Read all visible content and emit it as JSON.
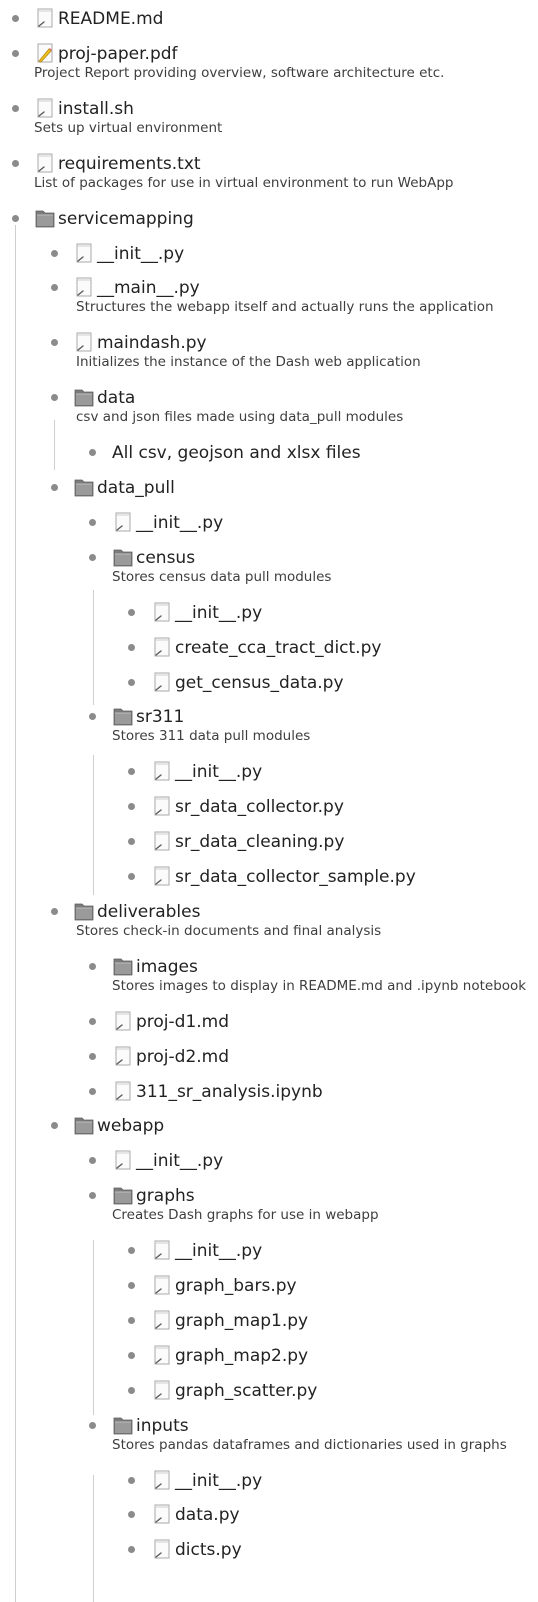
{
  "tree": [
    {
      "name": "README.md",
      "type": "file"
    },
    {
      "name": "proj-paper.pdf",
      "type": "pdf",
      "desc": "Project Report providing overview, software architecture etc."
    },
    {
      "name": "install.sh",
      "type": "file",
      "desc": "Sets up virtual environment"
    },
    {
      "name": "requirements.txt",
      "type": "file",
      "desc": "List of packages for use in virtual environment to run WebApp"
    },
    {
      "name": "servicemapping",
      "type": "folder",
      "children": [
        {
          "name": "__init__.py",
          "type": "file"
        },
        {
          "name": "__main__.py",
          "type": "file",
          "desc": "Structures the webapp itself and actually runs the application"
        },
        {
          "name": "maindash.py",
          "type": "file",
          "desc": "Initializes the instance of the Dash web application"
        },
        {
          "name": "data",
          "type": "folder",
          "desc": "csv and json files made using data_pull modules",
          "children": [
            {
              "name": "All csv, geojson and xlsx files",
              "type": "text"
            }
          ]
        },
        {
          "name": "data_pull",
          "type": "folder",
          "children": [
            {
              "name": "__init__.py",
              "type": "file"
            },
            {
              "name": "census",
              "type": "folder",
              "desc": "Stores census data pull modules",
              "children": [
                {
                  "name": "__init__.py",
                  "type": "file"
                },
                {
                  "name": "create_cca_tract_dict.py",
                  "type": "file"
                },
                {
                  "name": "get_census_data.py",
                  "type": "file"
                }
              ]
            },
            {
              "name": "sr311",
              "type": "folder",
              "desc": "Stores 311 data pull modules",
              "children": [
                {
                  "name": "__init__.py",
                  "type": "file"
                },
                {
                  "name": "sr_data_collector.py",
                  "type": "file"
                },
                {
                  "name": "sr_data_cleaning.py",
                  "type": "file"
                },
                {
                  "name": "sr_data_collector_sample.py",
                  "type": "file"
                }
              ]
            }
          ]
        },
        {
          "name": "deliverables",
          "type": "folder",
          "desc": "Stores check-in documents and final analysis",
          "children": [
            {
              "name": "images",
              "type": "folder",
              "desc": "Stores images to display in README.md and .ipynb notebook"
            },
            {
              "name": "proj-d1.md",
              "type": "file"
            },
            {
              "name": "proj-d2.md",
              "type": "file"
            },
            {
              "name": "311_sr_analysis.ipynb",
              "type": "file"
            }
          ]
        },
        {
          "name": "webapp",
          "type": "folder",
          "children": [
            {
              "name": "__init__.py",
              "type": "file"
            },
            {
              "name": "graphs",
              "type": "folder",
              "desc": "Creates Dash graphs for use in webapp",
              "children": [
                {
                  "name": "__init__.py",
                  "type": "file"
                },
                {
                  "name": "graph_bars.py",
                  "type": "file"
                },
                {
                  "name": "graph_map1.py",
                  "type": "file"
                },
                {
                  "name": "graph_map2.py",
                  "type": "file"
                },
                {
                  "name": "graph_scatter.py",
                  "type": "file"
                }
              ]
            },
            {
              "name": "inputs",
              "type": "folder",
              "desc": "Stores pandas dataframes and dictionaries used in graphs",
              "children": [
                {
                  "name": "__init__.py",
                  "type": "file"
                },
                {
                  "name": "data.py",
                  "type": "file"
                },
                {
                  "name": "dicts.py",
                  "type": "file"
                }
              ]
            }
          ]
        }
      ]
    }
  ]
}
